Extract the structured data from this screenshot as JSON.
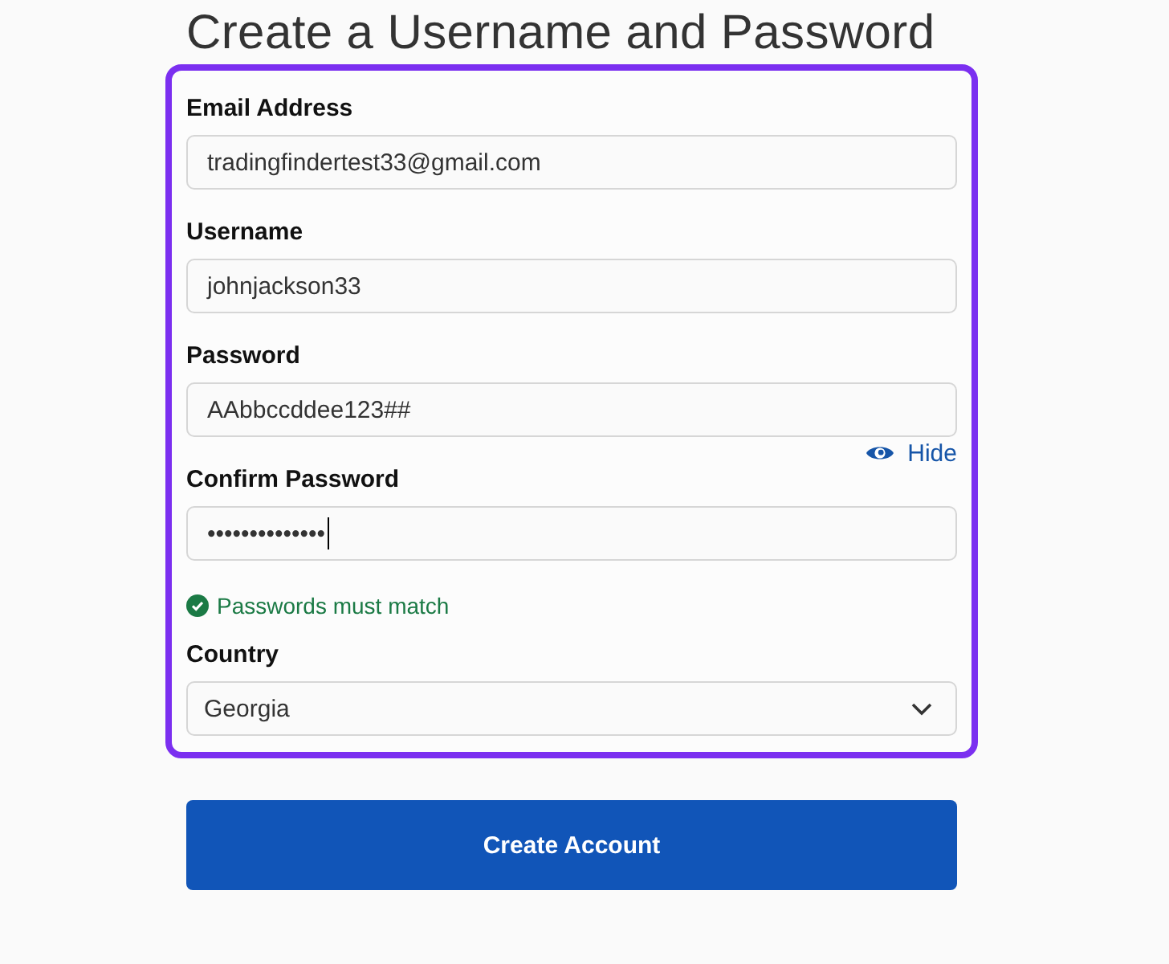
{
  "title": "Create a Username and Password",
  "fields": [
    {
      "kind": "input",
      "label": "Email Address",
      "value": "tradingfindertest33@gmail.com"
    },
    {
      "kind": "input",
      "label": "Username",
      "value": "johnjackson33"
    },
    {
      "kind": "input",
      "label": "Password",
      "value": "AAbbccddee123##",
      "toggle": {
        "label": "Hide"
      }
    },
    {
      "kind": "input",
      "label": "Confirm Password",
      "value": "••••••••••••••",
      "focused": true,
      "hint": {
        "text": "Passwords must match",
        "valid": true
      }
    },
    {
      "kind": "select",
      "label": "Country",
      "value": "Georgia"
    }
  ],
  "submit": {
    "label": "Create Account"
  }
}
